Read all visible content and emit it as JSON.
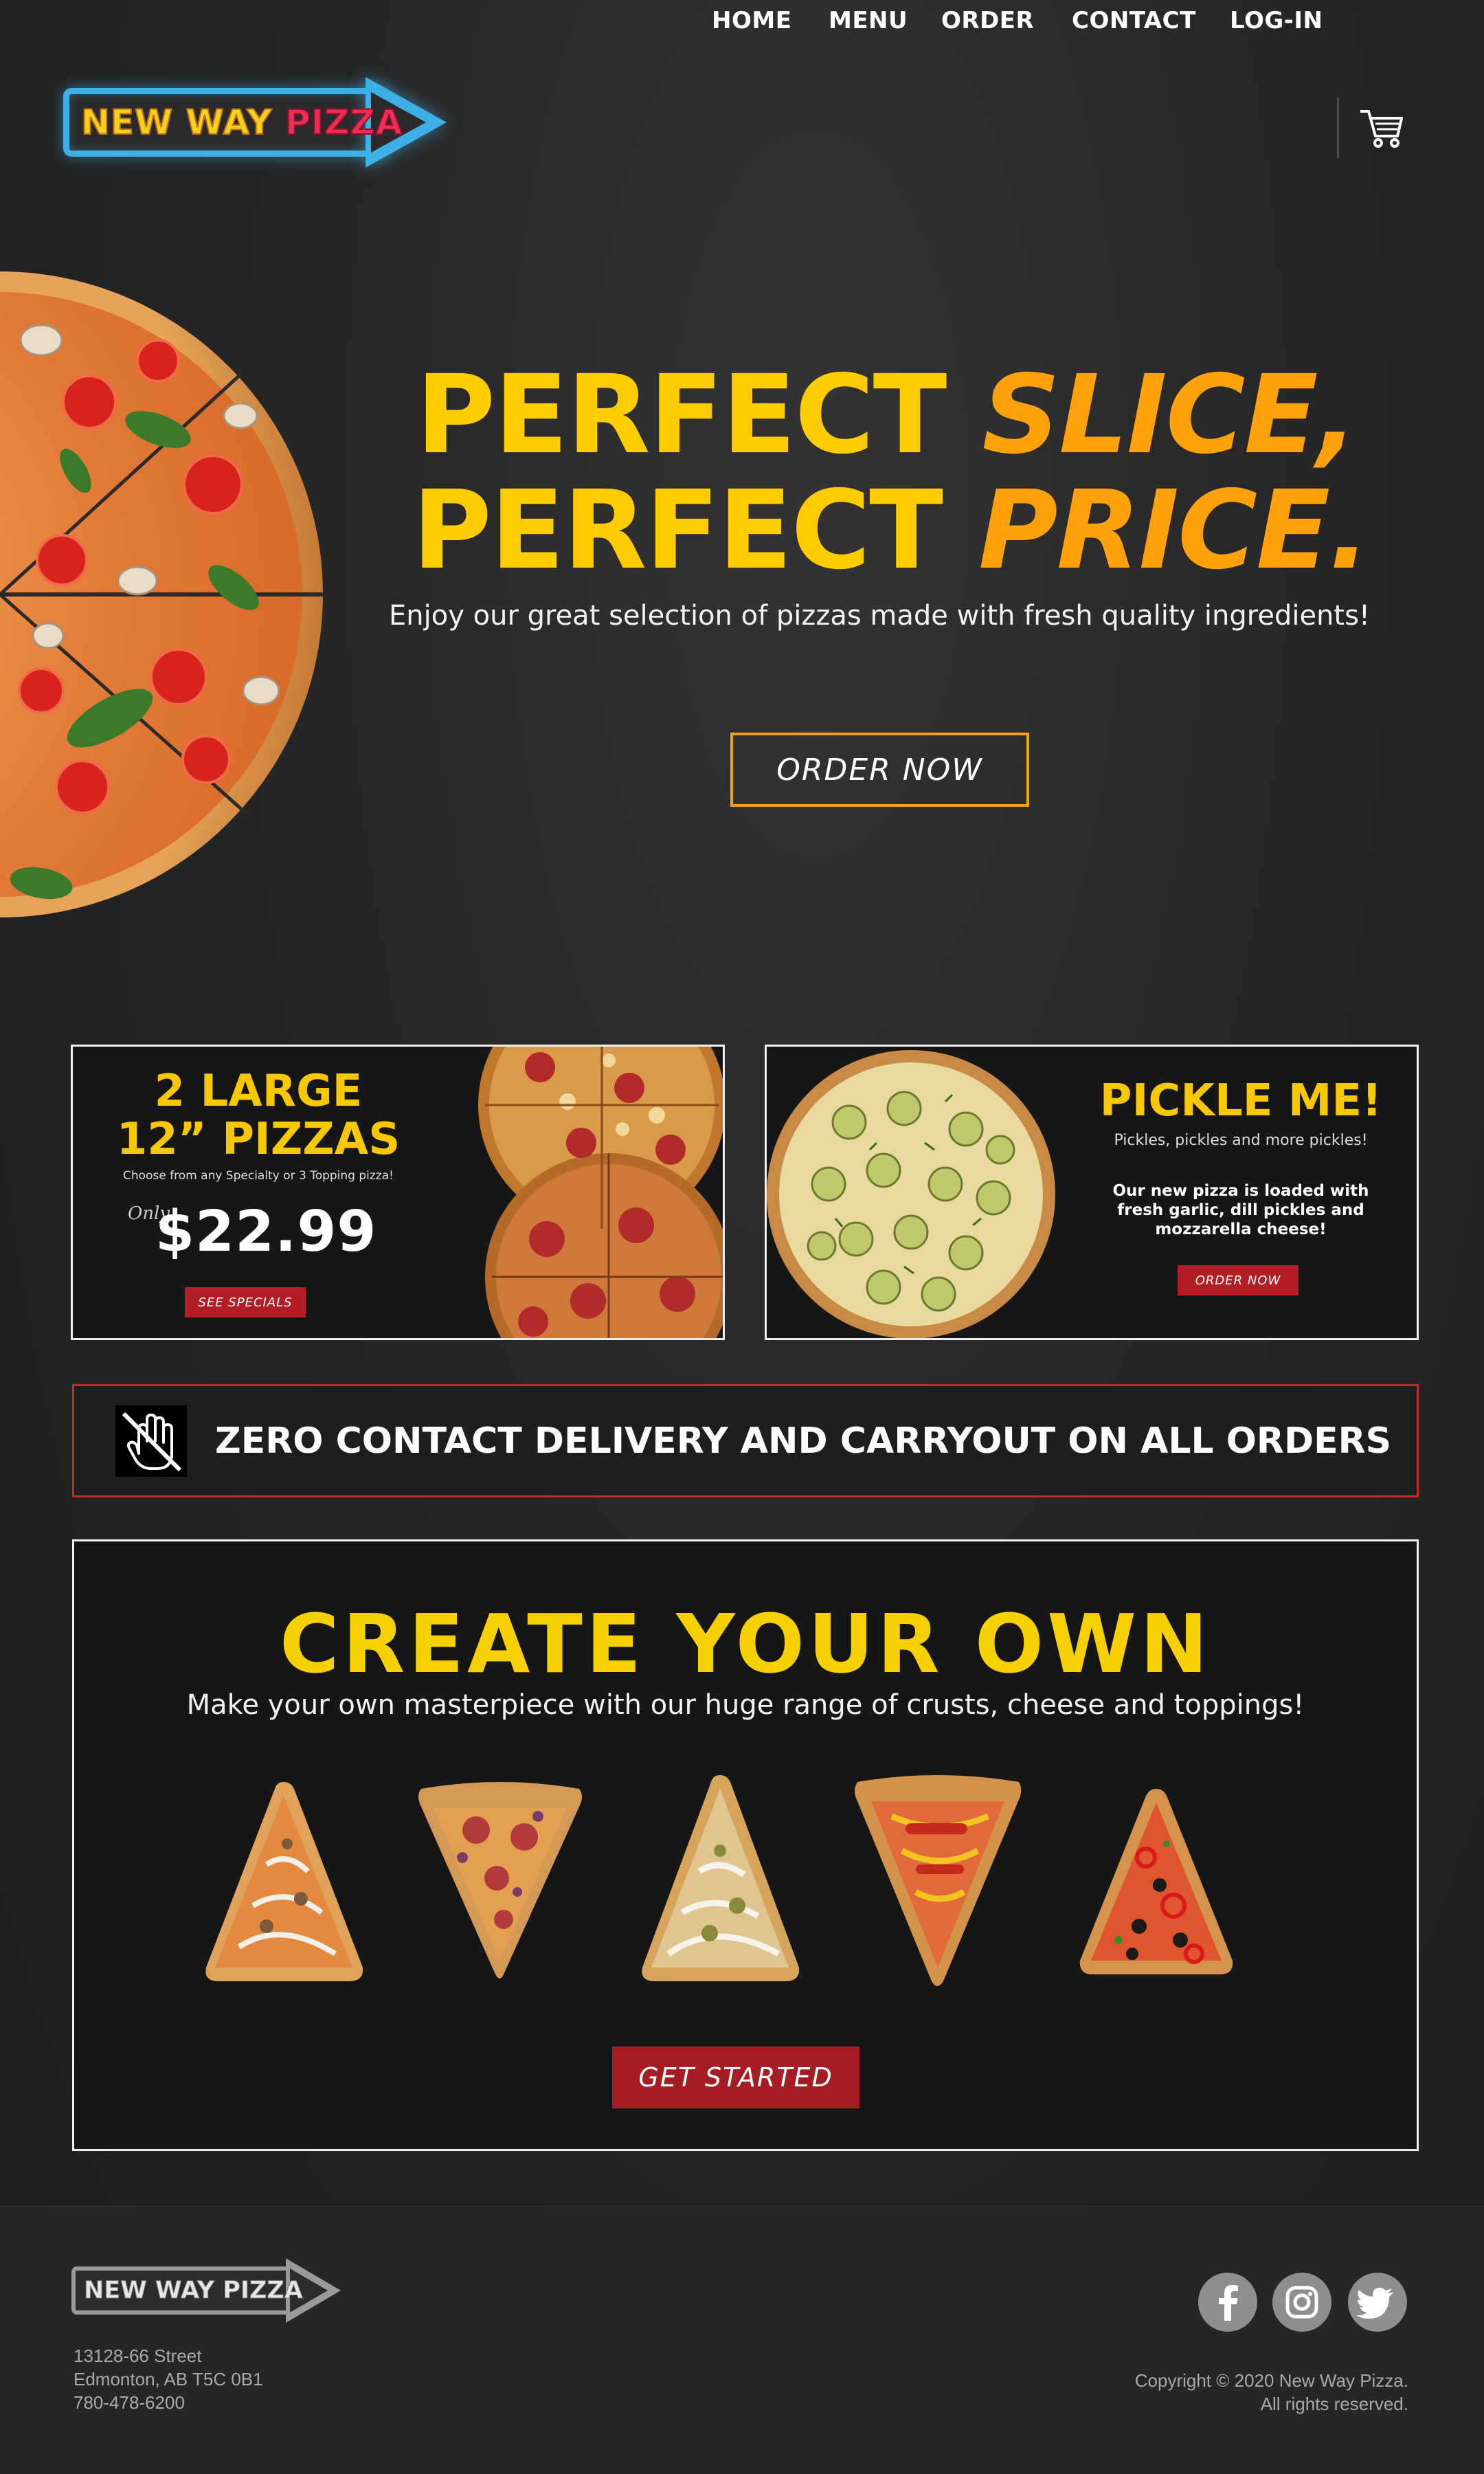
{
  "brand": {
    "logo_word1": "NEW WAY ",
    "logo_word2": "PIZZA",
    "footer_logo": "NEW WAY PIZZA"
  },
  "nav": {
    "items": [
      {
        "label": "HOME"
      },
      {
        "label": "MENU"
      },
      {
        "label": "ORDER"
      },
      {
        "label": "CONTACT"
      },
      {
        "label": "LOG-IN"
      }
    ]
  },
  "hero": {
    "line1_plain": "PERFECT ",
    "line1_italic": "SLICE,",
    "line2_plain": "PERFECT ",
    "line2_italic": "PRICE.",
    "subtitle": "Enjoy our great selection of pizzas made with fresh quality ingredients!",
    "cta_label": "ORDER NOW"
  },
  "promo1": {
    "title_line1": "2 LARGE",
    "title_line2": "12” PIZZAS",
    "subtitle": "Choose from any Specialty or 3 Topping pizza!",
    "only_label": "Only",
    "price": "$22.99",
    "cta_label": "SEE SPECIALS"
  },
  "promo2": {
    "title": "PICKLE ME!",
    "tagline": "Pickles, pickles and more pickles!",
    "description": "Our new pizza is loaded with fresh garlic, dill pickles and mozzarella cheese!",
    "cta_label": "ORDER NOW"
  },
  "banner": {
    "text": "ZERO CONTACT DELIVERY AND CARRYOUT ON ALL ORDERS"
  },
  "create": {
    "title": "CREATE YOUR OWN",
    "subtitle": "Make your own masterpiece with our huge range of crusts, cheese and toppings!",
    "cta_label": "GET STARTED"
  },
  "footer": {
    "address_line1": "13128-66 Street",
    "address_line2": "Edmonton, AB T5C 0B1",
    "phone": "780-478-6200",
    "copyright_line1": "Copyright © 2020 New Way Pizza.",
    "copyright_line2": "All rights reserved.",
    "social": [
      "facebook-icon",
      "instagram-icon",
      "twitter-icon"
    ]
  },
  "colors": {
    "accent_yellow": "#ffcc00",
    "accent_orange": "#ffa10a",
    "accent_red": "#b51d24",
    "logo_blue": "#3fb0e6",
    "background": "#222222"
  }
}
